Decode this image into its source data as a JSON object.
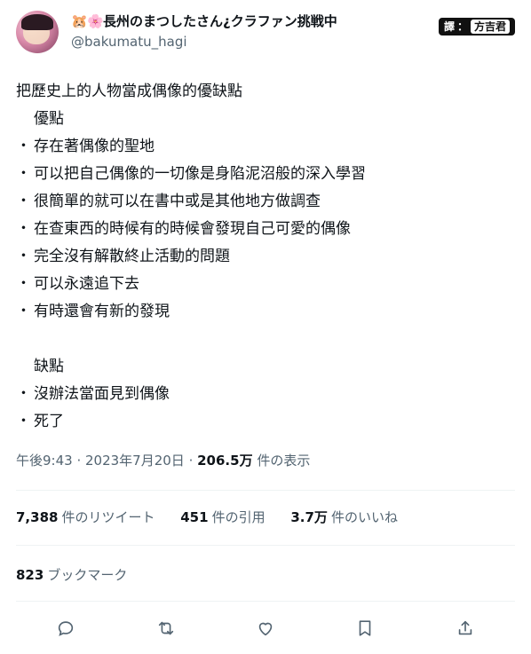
{
  "author": {
    "display_name": "長州のまつしたさん¿クラファン挑戦中",
    "emoji_1": "🐹",
    "emoji_2": "🌸",
    "handle": "@bakumatu_hagi"
  },
  "translator_badge": {
    "label": "譯",
    "separator": "：",
    "name": "方吉君"
  },
  "post": {
    "lines": [
      {
        "type": "text",
        "text": "把歷史上的人物當成偶像的優缺點"
      },
      {
        "type": "heading",
        "text": "優點"
      },
      {
        "type": "bullet",
        "bullet": "・",
        "text": "存在著偶像的聖地"
      },
      {
        "type": "bullet",
        "bullet": "・",
        "text": "可以把自己偶像的一切像是身陷泥沼般的深入學習"
      },
      {
        "type": "bullet",
        "bullet": "・",
        "text": "很簡單的就可以在書中或是其他地方做調查"
      },
      {
        "type": "bullet",
        "bullet": "・",
        "text": "在查東西的時候有的時候會發現自己可愛的偶像"
      },
      {
        "type": "bullet",
        "bullet": "・",
        "text": "完全沒有解散終止活動的問題"
      },
      {
        "type": "bullet",
        "bullet": "・",
        "text": "可以永遠追下去"
      },
      {
        "type": "bullet",
        "bullet": "・",
        "text": "有時還會有新的發現"
      },
      {
        "type": "blank",
        "text": ""
      },
      {
        "type": "heading",
        "text": "缺點"
      },
      {
        "type": "bullet",
        "bullet": "・",
        "text": "沒辦法當面見到偶像"
      },
      {
        "type": "bullet",
        "bullet": "・",
        "text": "死了"
      }
    ]
  },
  "meta": {
    "time": "午後9:43",
    "sep1": " · ",
    "date": "2023年7月20日",
    "sep2": " · ",
    "views_count": "206.5万",
    "views_label": " 件の表示"
  },
  "stats": {
    "retweets_count": "7,388",
    "retweets_label": "件のリツイート",
    "quotes_count": "451",
    "quotes_label": "件の引用",
    "likes_count": "3.7万",
    "likes_label": "件のいいね"
  },
  "bookmarks": {
    "count": "823",
    "label": "ブックマーク"
  },
  "actions": [
    "reply-icon",
    "retweet-icon",
    "like-icon",
    "bookmark-icon",
    "share-icon"
  ],
  "colors": {
    "text": "#0f1419",
    "muted": "#536471",
    "divider": "#eff3f4"
  }
}
